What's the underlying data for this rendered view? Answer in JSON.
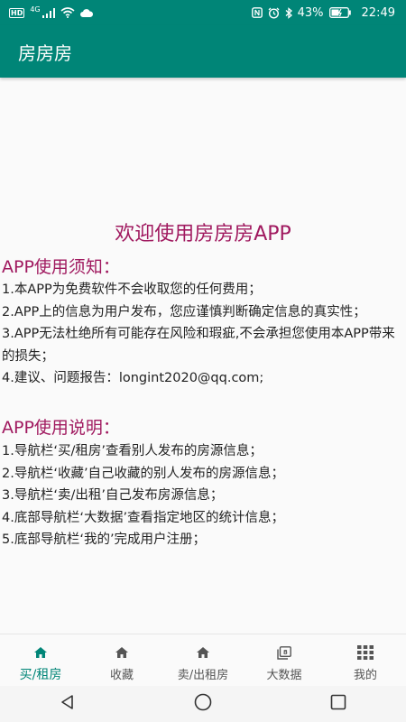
{
  "status_bar": {
    "hd": "HD",
    "network": "4G",
    "battery": "43%",
    "time": "22:49"
  },
  "app_bar": {
    "title": "房房房"
  },
  "content": {
    "welcome": "欢迎使用房房房APP",
    "notice_title": "APP使用须知：",
    "notice_items": [
      "1.本APP为免费软件不会收取您的任何费用；",
      "2.APP上的信息为用户发布，您应谨慎判断确定信息的真实性；",
      "3.APP无法杜绝所有可能存在风险和瑕疵,不会承担您使用本APP带来的损失；",
      "4.建议、问题报告：longint2020@qq.com;"
    ],
    "guide_title": "APP使用说明：",
    "guide_items": [
      "1.导航栏‘买/租房’查看别人发布的房源信息；",
      "2.导航栏‘收藏’自己收藏的别人发布的房源信息；",
      "3.导航栏‘卖/出租’自己发布房源信息；",
      "4.底部导航栏‘大数据’查看指定地区的统计信息；",
      "5.底部导航栏‘我的’完成用户注册；"
    ]
  },
  "bottom_nav": {
    "items": [
      {
        "label": "买/租房",
        "icon": "home-icon",
        "active": true
      },
      {
        "label": "收藏",
        "icon": "home-icon"
      },
      {
        "label": "卖/出租房",
        "icon": "home-icon"
      },
      {
        "label": "大数据",
        "icon": "data-icon"
      },
      {
        "label": "我的",
        "icon": "grid-icon"
      }
    ]
  },
  "colors": {
    "primary": "#008577",
    "accent": "#a0195f"
  }
}
